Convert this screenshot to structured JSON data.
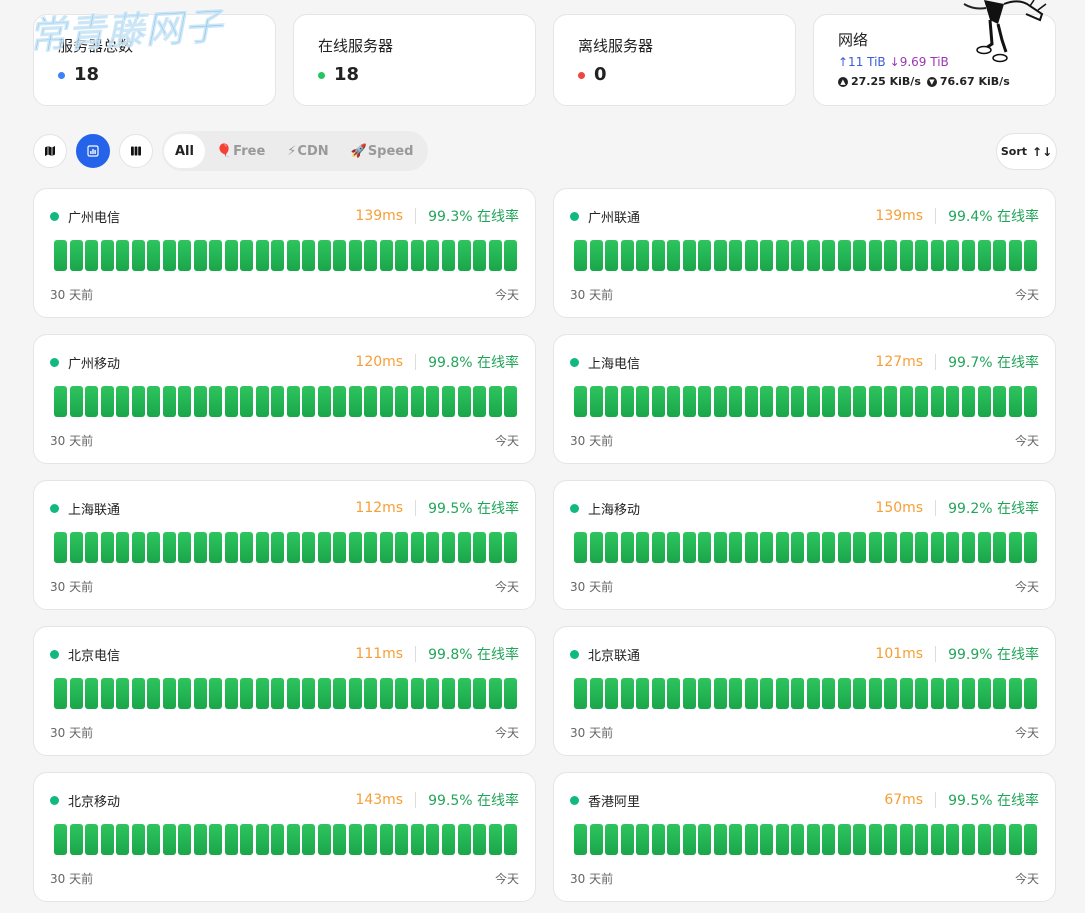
{
  "stats": [
    {
      "label": "服务器总数",
      "value": "18",
      "dot_color": "#3b82f6"
    },
    {
      "label": "在线服务器",
      "value": "18",
      "dot_color": "#22c55e"
    },
    {
      "label": "离线服务器",
      "value": "0",
      "dot_color": "#ef4444"
    }
  ],
  "network": {
    "title": "网络",
    "upload_total": "↑11 TiB",
    "download_total": "↓9.69 TiB",
    "upload_speed": "27.25 KiB/s",
    "download_speed": "76.67 KiB/s"
  },
  "watermark": "常青藤网子",
  "views": [
    {
      "name": "map-view-button",
      "icon": "map-icon",
      "active": false
    },
    {
      "name": "chart-view-button",
      "icon": "chart-icon",
      "active": true
    },
    {
      "name": "column-view-button",
      "icon": "columns-icon",
      "active": false
    }
  ],
  "filters": [
    {
      "label": "All",
      "icon": "",
      "active": true
    },
    {
      "label": "Free",
      "icon": "🎈",
      "active": false
    },
    {
      "label": "CDN",
      "icon": "⚡",
      "active": false
    },
    {
      "label": "Speed",
      "icon": "🚀",
      "active": false
    }
  ],
  "sort_label": "Sort",
  "sort_icon": "sort-arrows-icon",
  "bar_count": 30,
  "monitors": [
    {
      "name": "广州电信",
      "latency": "139ms",
      "uptime": "99.3% 在线率",
      "start": "30 天前",
      "end": "今天"
    },
    {
      "name": "广州联通",
      "latency": "139ms",
      "uptime": "99.4% 在线率",
      "start": "30 天前",
      "end": "今天"
    },
    {
      "name": "广州移动",
      "latency": "120ms",
      "uptime": "99.8% 在线率",
      "start": "30 天前",
      "end": "今天"
    },
    {
      "name": "上海电信",
      "latency": "127ms",
      "uptime": "99.7% 在线率",
      "start": "30 天前",
      "end": "今天"
    },
    {
      "name": "上海联通",
      "latency": "112ms",
      "uptime": "99.5% 在线率",
      "start": "30 天前",
      "end": "今天"
    },
    {
      "name": "上海移动",
      "latency": "150ms",
      "uptime": "99.2% 在线率",
      "start": "30 天前",
      "end": "今天"
    },
    {
      "name": "北京电信",
      "latency": "111ms",
      "uptime": "99.8% 在线率",
      "start": "30 天前",
      "end": "今天"
    },
    {
      "name": "北京联通",
      "latency": "101ms",
      "uptime": "99.9% 在线率",
      "start": "30 天前",
      "end": "今天"
    },
    {
      "name": "北京移动",
      "latency": "143ms",
      "uptime": "99.5% 在线率",
      "start": "30 天前",
      "end": "今天"
    },
    {
      "name": "香港阿里",
      "latency": "67ms",
      "uptime": "99.5% 在线率",
      "start": "30 天前",
      "end": "今天"
    }
  ],
  "colors": {
    "accent": "#2563eb",
    "online": "#10b981",
    "latency": "#f59f36",
    "uptime": "#22a55a",
    "bar": "#22b552"
  }
}
